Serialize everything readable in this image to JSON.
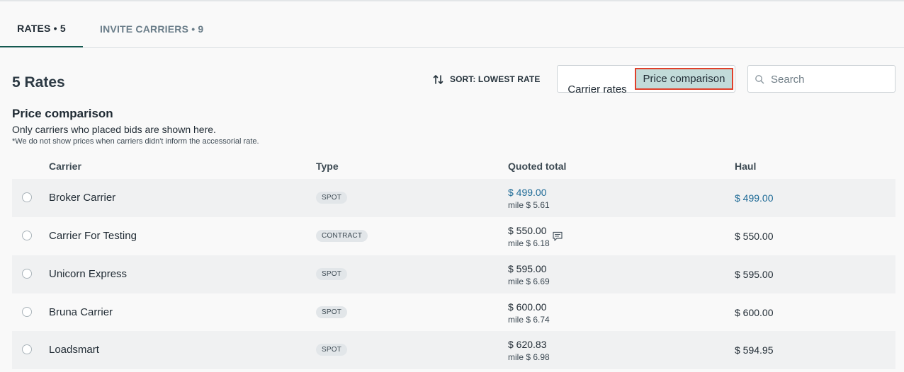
{
  "tabs": {
    "rates": "RATES • 5",
    "invite": "INVITE CARRIERS • 9"
  },
  "header": {
    "title": "5 Rates",
    "sort_label": "SORT: LOWEST RATE",
    "view_toggle": {
      "carrier_rates": "Carrier rates",
      "price_comparison": "Price comparison",
      "selected": "Price comparison"
    },
    "search_placeholder": "Search"
  },
  "section": {
    "heading": "Price comparison",
    "subtitle": "Only carriers who placed bids are shown here.",
    "note": "*We do not show prices when carriers didn't inform the accessorial rate."
  },
  "table": {
    "columns": {
      "carrier": "Carrier",
      "type": "Type",
      "quoted_total": "Quoted total",
      "haul": "Haul"
    },
    "rows": [
      {
        "carrier": "Broker Carrier",
        "type": "SPOT",
        "quoted": "$ 499.00",
        "mile": "mile $ 5.61",
        "haul": "$ 499.00"
      },
      {
        "carrier": "Carrier For Testing",
        "type": "CONTRACT",
        "quoted": "$ 550.00",
        "mile": "mile $ 6.18",
        "haul": "$ 550.00"
      },
      {
        "carrier": "Unicorn Express",
        "type": "SPOT",
        "quoted": "$ 595.00",
        "mile": "mile $ 6.69",
        "haul": "$ 595.00"
      },
      {
        "carrier": "Bruna Carrier",
        "type": "SPOT",
        "quoted": "$ 600.00",
        "mile": "mile $ 6.74",
        "haul": "$ 600.00"
      },
      {
        "carrier": "Loadsmart",
        "type": "SPOT",
        "quoted": "$ 620.83",
        "mile": "mile $ 6.98",
        "haul": "$ 594.95"
      }
    ]
  },
  "colors": {
    "accent": "#14594f",
    "selected_toggle_bg": "#c2dbd9",
    "highlight_outline": "#e0402a",
    "link": "#1d6a96"
  },
  "icons": {
    "sort": "sort-arrows-icon",
    "search": "search-icon",
    "comment": "comment-icon",
    "radio": "radio-icon"
  }
}
